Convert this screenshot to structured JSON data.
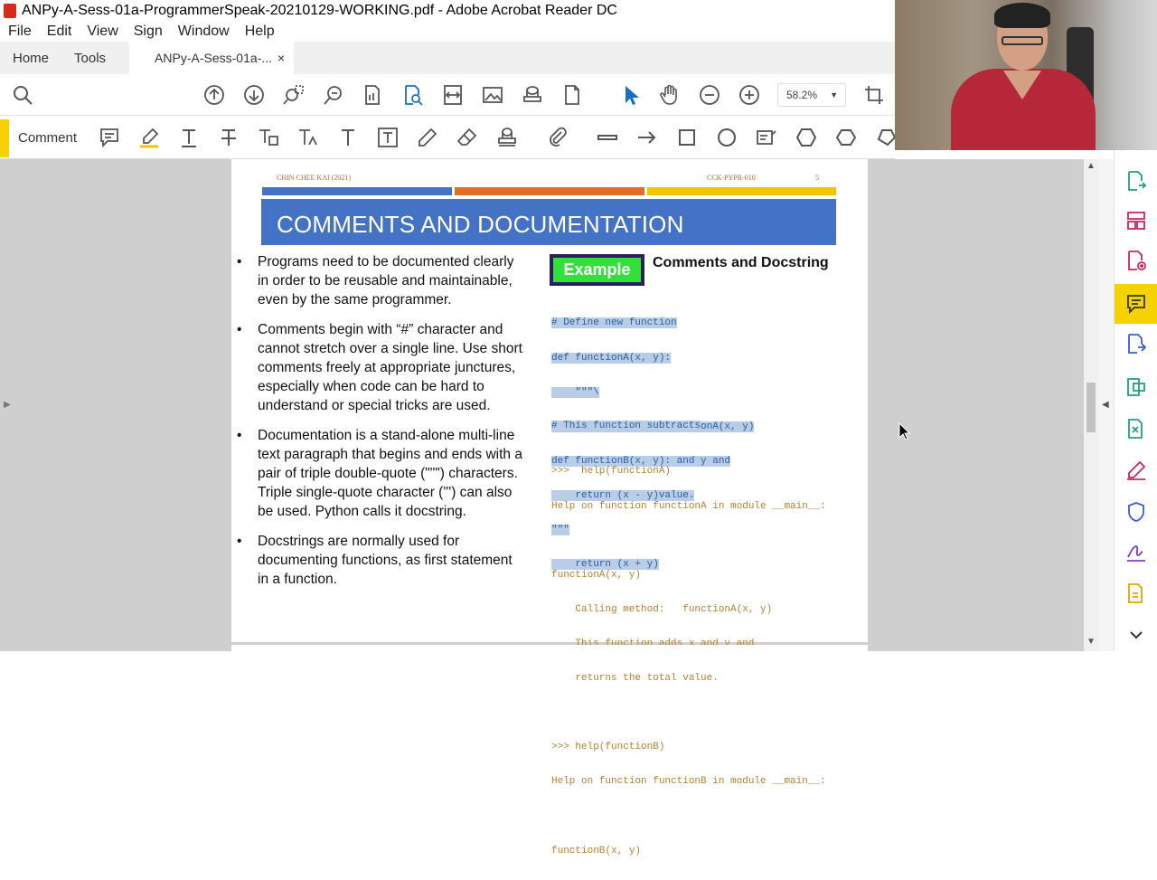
{
  "window": {
    "title": "ANPy-A-Sess-01a-ProgrammerSpeak-20210129-WORKING.pdf - Adobe Acrobat Reader DC"
  },
  "menu": [
    "File",
    "Edit",
    "View",
    "Sign",
    "Window",
    "Help"
  ],
  "tabs": {
    "home": "Home",
    "tools": "Tools",
    "document": "ANPy-A-Sess-01a-...",
    "close": "×"
  },
  "toolbar": {
    "zoom": "58.2%"
  },
  "comment_toolbar": {
    "label": "Comment"
  },
  "slide": {
    "header_left": "CHIN CHEE KAI (2021)",
    "header_mid": "CCK-PYPR-010",
    "page_number": "5",
    "title": "COMMENTS AND DOCUMENTATION",
    "bullets": [
      "Programs need to be documented clearly in order to be reusable and maintainable, even by the same programmer.",
      "Comments begin with “#” character and cannot stretch over a single line.  Use short comments freely at appropriate junctures, especially when code can be hard to understand or special tricks are used.",
      "Documentation is a stand-alone multi-line text paragraph that begins and ends with a pair of triple double-quote (\"\"\") characters.  Triple single-quote character (''') can also be used.  Python calls it docstring.",
      "Docstrings are normally used for documenting functions, as first statement in a function."
    ],
    "example_label": "Example",
    "example_title": "Comments and Docstring",
    "code_block_1": [
      "# Define new function",
      "def functionA(x, y):",
      "    \"\"\"\\",
      "Calling method:    functionA(x, y)",
      "This function adds x and y and",
      "returns the total value.",
      "\"\"\"",
      "    return (x + y)"
    ],
    "code_block_2": [
      "# This function subtracts",
      "def functionB(x, y):",
      "    return (x - y)"
    ],
    "output_lines": [
      ">>>  help(functionA)",
      "Help on function functionA in module __main__:",
      "",
      "functionA(x, y)",
      "    Calling method:   functionA(x, y)",
      "    This function adds x and y and",
      "    returns the total value.",
      "",
      ">>> help(functionB)",
      "Help on function functionB in module __main__:",
      "",
      "functionB(x, y)"
    ]
  },
  "colors": {
    "banner": "#4472c4",
    "stripe_blue": "#4472c4",
    "stripe_orange": "#e46c29",
    "stripe_yellow": "#f5c400",
    "accent_yellow": "#f5d300"
  },
  "icons": {
    "toolbar": [
      "search-icon",
      "page-up-icon",
      "page-down-icon",
      "zoom-region-icon",
      "zoom-search-icon",
      "page-thumbnail-icon",
      "find-icon",
      "fit-width-icon",
      "image-icon",
      "stamp-icon",
      "page-icon",
      "select-cursor-icon",
      "hand-icon",
      "zoom-out-icon",
      "zoom-in-icon",
      "crop-icon"
    ],
    "comment": [
      "sticky-note-icon",
      "highlight-icon",
      "text-icon",
      "strikethrough-icon",
      "replace-text-icon",
      "text-edit-icon",
      "add-text-icon",
      "text-box-icon",
      "pencil-icon",
      "eraser-icon",
      "stamp-icon",
      "attach-icon",
      "line-icon",
      "arrow-icon",
      "rectangle-icon",
      "oval-icon",
      "comment-box-icon",
      "polygon-icon",
      "cloud-icon",
      "polygon-line-icon"
    ],
    "right_panel": [
      "export-pdf-icon",
      "organize-pages-icon",
      "create-pdf-icon",
      "comment-icon",
      "convert-icon",
      "edit-pdf-icon",
      "compress-icon",
      "fill-sign-icon",
      "protect-icon",
      "sign-icon",
      "more-tools-icon",
      "scroll-down-icon"
    ]
  }
}
